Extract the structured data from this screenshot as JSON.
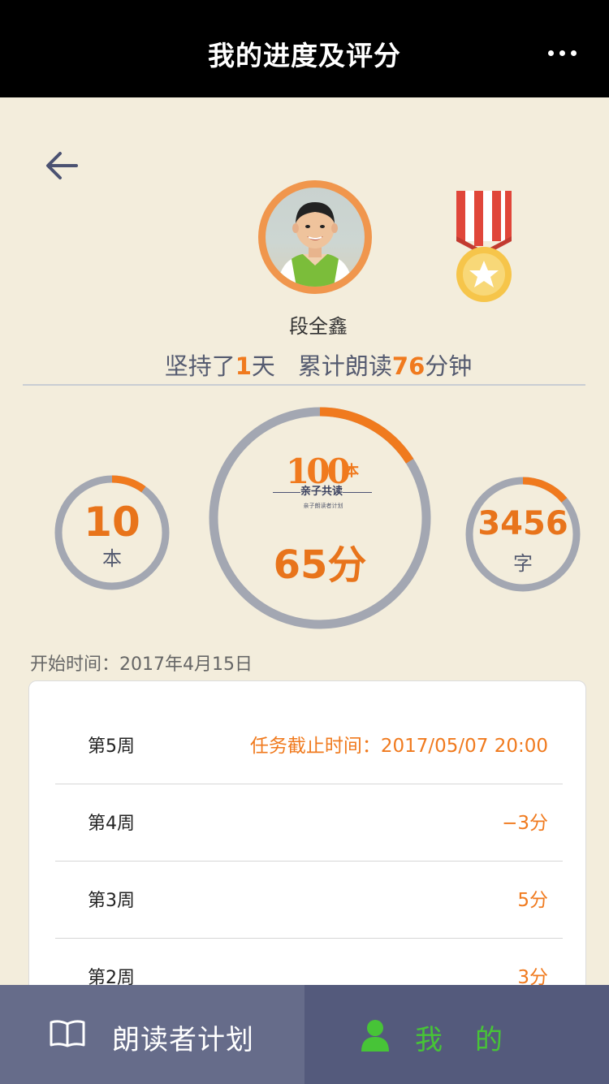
{
  "header": {
    "title": "我的进度及评分"
  },
  "profile": {
    "name": "段全鑫",
    "stats": {
      "prefix": "坚持了",
      "days": "1",
      "days_unit": "天",
      "read_prefix": "累计朗读",
      "minutes": "76",
      "minutes_unit": "分钟"
    }
  },
  "gauges": {
    "books": {
      "value": "10",
      "unit": "本",
      "progress": 0.1
    },
    "score": {
      "value": "65分",
      "logo_num": "100",
      "logo_unit": "本",
      "logo_badge": "亲子共读",
      "logo_caption": "亲子朗读者计划",
      "progress": 0.16
    },
    "words": {
      "value": "3456",
      "unit": "字",
      "progress": 0.14
    }
  },
  "start_time": "开始时间：2017年4月15日",
  "weeks": [
    {
      "label": "第5周",
      "value": "任务截止时间：2017/05/07  20:00"
    },
    {
      "label": "第4周",
      "value": "−3分"
    },
    {
      "label": "第3周",
      "value": "5分"
    },
    {
      "label": "第2周",
      "value": "3分"
    }
  ],
  "nav": {
    "plan_label": "朗读者计划",
    "mine_label": "我的"
  },
  "colors": {
    "accent": "#f07a1e",
    "ring_track": "#a3a7b2",
    "background": "#f3eddc",
    "nav_left": "#666c8a",
    "nav_right": "#545a7c",
    "nav_active": "#47c437"
  }
}
